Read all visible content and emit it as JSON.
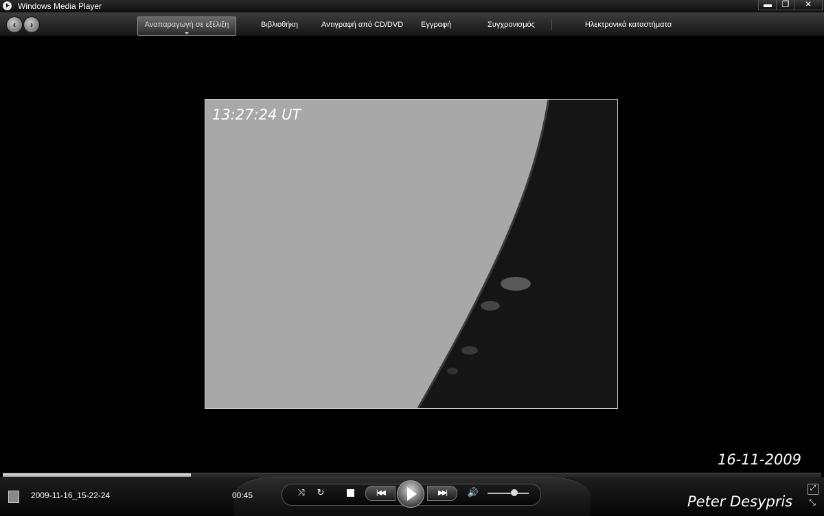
{
  "window": {
    "title": "Windows Media Player",
    "buttons": {
      "minimize": "▬",
      "maximize": "❐",
      "close": "✕"
    }
  },
  "nav": {
    "back_icon": "back-arrow-icon",
    "forward_icon": "forward-arrow-icon",
    "back_glyph": "‹",
    "forward_glyph": "›",
    "tabs": {
      "now_playing": "Αναπαραγωγή σε εξέλιξη",
      "library": "Βιβλιοθήκη",
      "rip": "Αντιγραφή από CD/DVD",
      "burn": "Εγγραφή",
      "sync": "Συγχρονισμός",
      "stores": "Ηλεκτρονικά καταστήματα"
    }
  },
  "video": {
    "timestamp": "13:27:24 UT",
    "date": "16-11-2009"
  },
  "playback": {
    "seek_progress": 0.23,
    "file_name": "2009-11-16_15-22-24",
    "elapsed": "00:45",
    "volume": 0.65,
    "glyphs": {
      "shuffle": "⤨",
      "repeat": "↻",
      "prev": "|◀◀",
      "next": "▶▶|",
      "mute": "🔊",
      "fullscreen": "⤢",
      "compact": "⤡"
    }
  },
  "credit": "Peter Desypris",
  "colors": {
    "background": "#000000",
    "sky": "#a8a8a8",
    "sun_disk": "#151515"
  }
}
